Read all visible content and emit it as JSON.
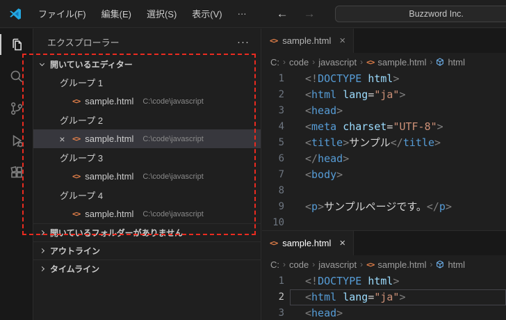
{
  "icons": {
    "html_file": "<>",
    "close": "×",
    "crumb_sep": "›",
    "more": "···"
  },
  "colors": {
    "accent_blue": "#24a9e2",
    "tag": "#569cd6",
    "attr": "#9cdcfe",
    "string": "#ce9178",
    "annotation_red": "#ec2b20",
    "selected_row": "#37373d"
  },
  "title_bar": {
    "menus": [
      "ファイル(F)",
      "編集(E)",
      "選択(S)",
      "表示(V)"
    ],
    "overflow": "···",
    "back": "←",
    "forward": "→",
    "command_center": "Buzzword Inc."
  },
  "activity_bar": {
    "items": [
      "explorer",
      "search",
      "source-control",
      "run-and-debug",
      "extensions"
    ]
  },
  "sidebar": {
    "title": "エクスプローラー",
    "open_editors": {
      "label": "開いているエディター",
      "groups": [
        {
          "label": "グループ 1",
          "file": "sample.html",
          "path": "C:\\code\\javascript",
          "selected": false
        },
        {
          "label": "グループ 2",
          "file": "sample.html",
          "path": "C:\\code\\javascript",
          "selected": true
        },
        {
          "label": "グループ 3",
          "file": "sample.html",
          "path": "C:\\code\\javascript",
          "selected": false
        },
        {
          "label": "グループ 4",
          "file": "sample.html",
          "path": "C:\\code\\javascript",
          "selected": false
        }
      ]
    },
    "sections": [
      "開いているフォルダーがありません",
      "アウトライン",
      "タイムライン"
    ]
  },
  "editors": [
    {
      "tab": "sample.html",
      "breadcrumb": [
        "C:",
        "code",
        "javascript",
        "sample.html",
        "html"
      ],
      "active_line": null,
      "lines": [
        {
          "n": 1,
          "tk": [
            [
              "<!",
              "p"
            ],
            [
              "DOCTYPE",
              "t"
            ],
            [
              " ",
              "d"
            ],
            [
              "html",
              "a"
            ],
            [
              ">",
              "p"
            ]
          ]
        },
        {
          "n": 2,
          "tk": [
            [
              "<",
              "p"
            ],
            [
              "html",
              "t"
            ],
            [
              " ",
              "d"
            ],
            [
              "lang",
              "a"
            ],
            [
              "=",
              "d"
            ],
            [
              "\"ja\"",
              "s"
            ],
            [
              ">",
              "p"
            ]
          ]
        },
        {
          "n": 3,
          "tk": [
            [
              "<",
              "p"
            ],
            [
              "head",
              "t"
            ],
            [
              ">",
              "p"
            ]
          ]
        },
        {
          "n": 4,
          "tk": [
            [
              "<",
              "p"
            ],
            [
              "meta",
              "t"
            ],
            [
              " ",
              "d"
            ],
            [
              "charset",
              "a"
            ],
            [
              "=",
              "d"
            ],
            [
              "\"UTF-8\"",
              "s"
            ],
            [
              ">",
              "p"
            ]
          ]
        },
        {
          "n": 5,
          "tk": [
            [
              "<",
              "p"
            ],
            [
              "title",
              "t"
            ],
            [
              ">",
              "p"
            ],
            [
              "サンプル",
              "x"
            ],
            [
              "</",
              "p"
            ],
            [
              "title",
              "t"
            ],
            [
              ">",
              "p"
            ]
          ]
        },
        {
          "n": 6,
          "tk": [
            [
              "</",
              "p"
            ],
            [
              "head",
              "t"
            ],
            [
              ">",
              "p"
            ]
          ]
        },
        {
          "n": 7,
          "tk": [
            [
              "<",
              "p"
            ],
            [
              "body",
              "t"
            ],
            [
              ">",
              "p"
            ]
          ]
        },
        {
          "n": 8,
          "tk": []
        },
        {
          "n": 9,
          "tk": [
            [
              "<",
              "p"
            ],
            [
              "p",
              "t"
            ],
            [
              ">",
              "p"
            ],
            [
              "サンプルページです。",
              "x"
            ],
            [
              "</",
              "p"
            ],
            [
              "p",
              "t"
            ],
            [
              ">",
              "p"
            ]
          ]
        },
        {
          "n": 10,
          "tk": []
        }
      ]
    },
    {
      "tab": "sample.html",
      "breadcrumb": [
        "C:",
        "code",
        "javascript",
        "sample.html",
        "html"
      ],
      "active_line": 2,
      "lines": [
        {
          "n": 1,
          "tk": [
            [
              "<!",
              "p"
            ],
            [
              "DOCTYPE",
              "t"
            ],
            [
              " ",
              "d"
            ],
            [
              "html",
              "a"
            ],
            [
              ">",
              "p"
            ]
          ]
        },
        {
          "n": 2,
          "tk": [
            [
              "<",
              "p"
            ],
            [
              "html",
              "t"
            ],
            [
              " ",
              "d"
            ],
            [
              "lang",
              "a"
            ],
            [
              "=",
              "d"
            ],
            [
              "\"ja\"",
              "s"
            ],
            [
              ">",
              "p"
            ]
          ]
        },
        {
          "n": 3,
          "tk": [
            [
              "<",
              "p"
            ],
            [
              "head",
              "t"
            ],
            [
              ">",
              "p"
            ]
          ]
        }
      ]
    }
  ]
}
